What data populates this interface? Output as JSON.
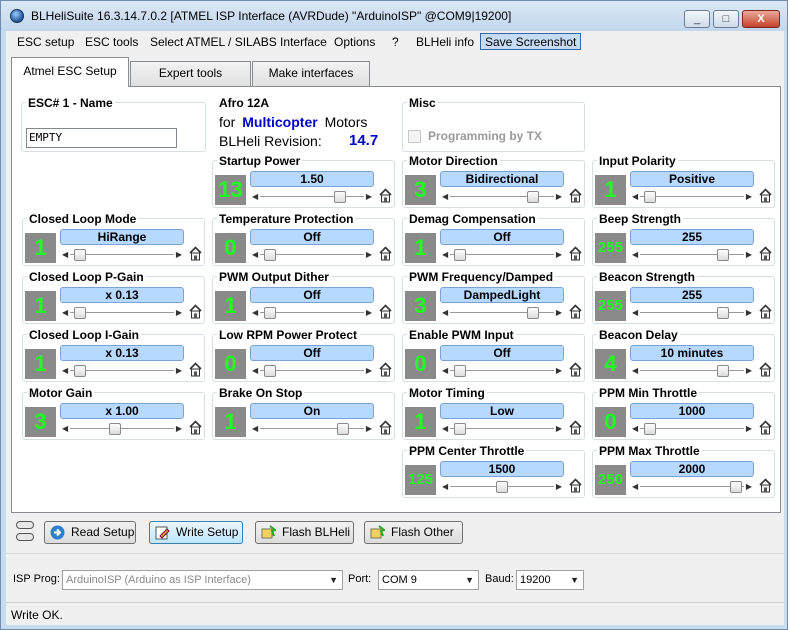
{
  "window": {
    "title": "BLHeliSuite 16.3.14.7.0.2  [ATMEL ISP Interface (AVRDude) \"ArduinoISP\" @COM9|19200]",
    "controls": [
      "_",
      "□",
      "X"
    ]
  },
  "menu": [
    "ESC setup",
    "ESC tools",
    "Select ATMEL / SILABS Interface",
    "Options",
    "?",
    "BLHeli info",
    "Save Screenshot"
  ],
  "tabs": [
    "Atmel ESC Setup",
    "Expert tools",
    "Make interfaces"
  ],
  "esc": {
    "name_title": "ESC# 1 - Name",
    "name_value": "EMPTY",
    "model": "Afro 12A",
    "for_label": "for",
    "for_type": "Multicopter",
    "motors_label": "Motors",
    "revision_label": "BLHeli Revision:",
    "revision": "14.7",
    "misc_title": "Misc",
    "misc_checkbox": "Programming by TX"
  },
  "params": [
    {
      "title": "Startup Power",
      "num": "13",
      "value": "1.50",
      "pos": 0.8
    },
    {
      "title": "Motor Direction",
      "num": "3",
      "value": "Bidirectional",
      "pos": 0.84
    },
    {
      "title": "Input Polarity",
      "num": "1",
      "value": "Positive",
      "pos": 0.04
    },
    {
      "title": "Closed Loop Mode",
      "num": "1",
      "value": "HiRange",
      "pos": 0.04
    },
    {
      "title": "Temperature Protection",
      "num": "0",
      "value": "Off",
      "pos": 0.04
    },
    {
      "title": "Demag Compensation",
      "num": "1",
      "value": "Off",
      "pos": 0.04
    },
    {
      "title": "Beep Strength",
      "num": "255",
      "value": "255",
      "pos": 0.84
    },
    {
      "title": "Closed Loop P-Gain",
      "num": "1",
      "value": "x 0.13",
      "pos": 0.04
    },
    {
      "title": "PWM Output Dither",
      "num": "1",
      "value": "Off",
      "pos": 0.04
    },
    {
      "title": "PWM Frequency/Damped",
      "num": "3",
      "value": "DampedLight",
      "pos": 0.84
    },
    {
      "title": "Beacon Strength",
      "num": "255",
      "value": "255",
      "pos": 0.84
    },
    {
      "title": "Closed Loop I-Gain",
      "num": "1",
      "value": "x 0.13",
      "pos": 0.04
    },
    {
      "title": "Low RPM Power Protect",
      "num": "0",
      "value": "Off",
      "pos": 0.04
    },
    {
      "title": "Enable PWM Input",
      "num": "0",
      "value": "Off",
      "pos": 0.04
    },
    {
      "title": "Beacon Delay",
      "num": "4",
      "value": "10 minutes",
      "pos": 0.84
    },
    {
      "title": "Motor Gain",
      "num": "3",
      "value": "x 1.00",
      "pos": 0.42
    },
    {
      "title": "Brake On Stop",
      "num": "1",
      "value": "On",
      "pos": 0.84
    },
    {
      "title": "Motor Timing",
      "num": "1",
      "value": "Low",
      "pos": 0.04
    },
    {
      "title": "PPM Min Throttle",
      "num": "0",
      "value": "1000",
      "pos": 0.04
    },
    {
      "title": "PPM Center Throttle",
      "num": "125",
      "value": "1500",
      "pos": 0.5
    },
    {
      "title": "PPM Max Throttle",
      "num": "250",
      "value": "2000",
      "pos": 0.98
    }
  ],
  "buttons": [
    "Read Setup",
    "Write Setup",
    "Flash BLHeli",
    "Flash Other"
  ],
  "bottom": {
    "isp_label": "ISP Prog:",
    "isp_value": "ArduinoISP (Arduino as ISP Interface)",
    "port_label": "Port:",
    "port_value": "COM 9",
    "baud_label": "Baud:",
    "baud_value": "19200"
  },
  "status": "Write OK.",
  "colors": {
    "digit": "#20ff20",
    "numbox": "#8a8a8a",
    "valbar": "#b7d8ff",
    "accent": "#0000cc"
  }
}
